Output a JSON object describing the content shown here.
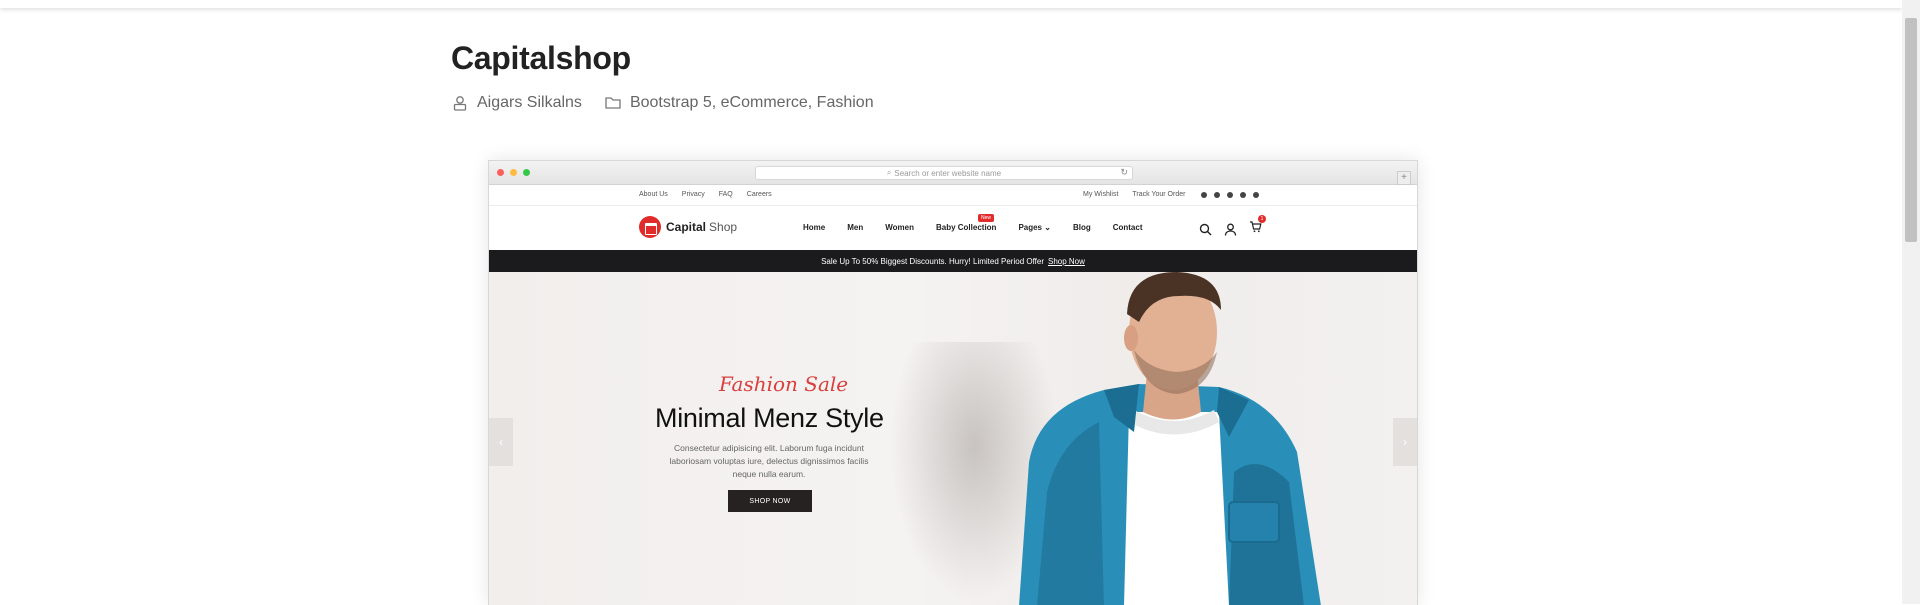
{
  "post": {
    "title": "Capitalshop",
    "author": "Aigars Silkalns",
    "categories": "Bootstrap 5, eCommerce, Fashion"
  },
  "browser": {
    "address_placeholder": "Search or enter website name",
    "new_tab_label": "+"
  },
  "site": {
    "util_left": [
      "About Us",
      "Privacy",
      "FAQ",
      "Careers"
    ],
    "util_right": [
      "My Wishlist",
      "Track Your Order"
    ],
    "logo_bold": "Capital",
    "logo_light": "Shop",
    "menu": [
      "Home",
      "Men",
      "Women",
      "Baby Collection",
      "Pages ⌄",
      "Blog",
      "Contact"
    ],
    "menu_badge": "New",
    "cart_count": "1",
    "promo_text": "Sale Up To 50% Biggest Discounts. Hurry! Limited Period Offer",
    "promo_link": "Shop Now",
    "hero": {
      "tag": "Fashion Sale",
      "headline": "Minimal Menz Style",
      "description": "Consectetur adipisicing elit. Laborum fuga incidunt laboriosam voluptas iure, delectus dignissimos facilis neque nulla earum.",
      "button": "SHOP NOW",
      "prev": "‹",
      "next": "›"
    }
  },
  "colors": {
    "accent": "#e02c2b",
    "promo_bg": "#1b1b1e",
    "jacket": "#2a8fb8"
  }
}
